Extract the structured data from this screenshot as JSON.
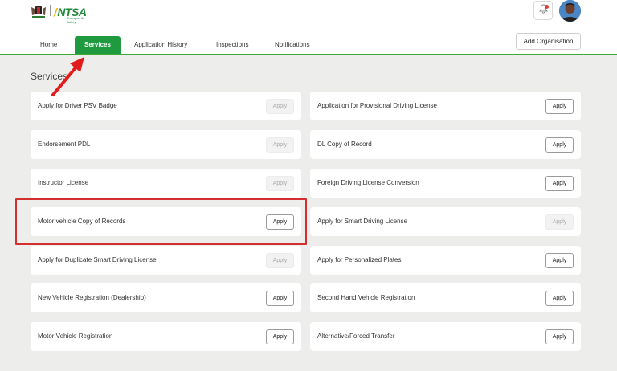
{
  "header": {
    "logo_ntsa": "NTSA",
    "logo_sub": "Transport & Safety",
    "avatar": "user-avatar",
    "notification_icon": "bell-icon"
  },
  "nav": {
    "tabs": [
      {
        "label": "Home",
        "active": false
      },
      {
        "label": "Services",
        "active": true
      },
      {
        "label": "Application History",
        "active": false
      },
      {
        "label": "Inspections",
        "active": false
      },
      {
        "label": "Notifications",
        "active": false
      }
    ],
    "add_org_label": "Add Organisation"
  },
  "main": {
    "title": "Services",
    "services_left": [
      {
        "name": "Apply for Driver PSV Badge",
        "button": "Apply",
        "enabled": false
      },
      {
        "name": "Endorsement PDL",
        "button": "Apply",
        "enabled": false
      },
      {
        "name": "Instructor License",
        "button": "Apply",
        "enabled": false
      },
      {
        "name": "Motor vehicle Copy of Records",
        "button": "Apply",
        "enabled": true
      },
      {
        "name": "Apply for Duplicate Smart Driving License",
        "button": "Apply",
        "enabled": false
      },
      {
        "name": "New Vehicle Registration (Dealership)",
        "button": "Apply",
        "enabled": true
      },
      {
        "name": "Motor Vehicle Registration",
        "button": "Apply",
        "enabled": true
      }
    ],
    "services_right": [
      {
        "name": "Application for Provisional Driving License",
        "button": "Apply",
        "enabled": true
      },
      {
        "name": "DL Copy of Record",
        "button": "Apply",
        "enabled": true
      },
      {
        "name": "Foreign Driving License Conversion",
        "button": "Apply",
        "enabled": true
      },
      {
        "name": "Apply for Smart Driving License",
        "button": "Apply",
        "enabled": false
      },
      {
        "name": "Apply for Personalized Plates",
        "button": "Apply",
        "enabled": true
      },
      {
        "name": "Second Hand Vehicle Registration",
        "button": "Apply",
        "enabled": true
      },
      {
        "name": "Alternative/Forced Transfer",
        "button": "Apply",
        "enabled": true
      }
    ]
  },
  "colors": {
    "accent_green": "#1f9a3f",
    "nav_underline": "#3aaa35",
    "annotation_red": "#d32f2f"
  }
}
